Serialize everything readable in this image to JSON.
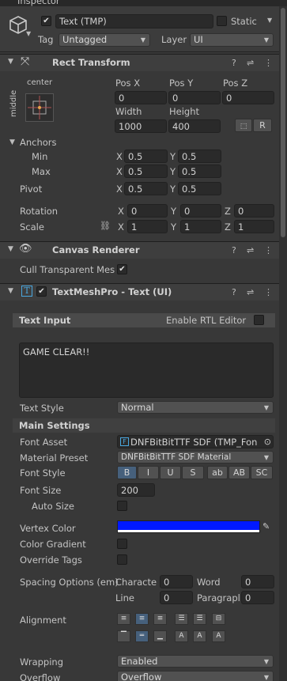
{
  "window": {
    "tab_title": "Inspector"
  },
  "object": {
    "active": true,
    "name": "Text (TMP)",
    "static_label": "Static",
    "static_checked": false,
    "tag_label": "Tag",
    "tag_value": "Untagged",
    "layer_label": "Layer",
    "layer_value": "UI"
  },
  "rect_transform": {
    "title": "Rect Transform",
    "anchor_preset_top": "center",
    "anchor_preset_side": "middle",
    "pos_x_label": "Pos X",
    "pos_y_label": "Pos Y",
    "pos_z_label": "Pos Z",
    "pos_x": "0",
    "pos_y": "0",
    "pos_z": "0",
    "width_label": "Width",
    "height_label": "Height",
    "width": "1000",
    "height": "400",
    "r_button": "R",
    "anchors_label": "Anchors",
    "min_label": "Min",
    "max_label": "Max",
    "x_label": "X",
    "y_label": "Y",
    "z_label": "Z",
    "min_x": "0.5",
    "min_y": "0.5",
    "max_x": "0.5",
    "max_y": "0.5",
    "pivot_label": "Pivot",
    "pivot_x": "0.5",
    "pivot_y": "0.5",
    "rotation_label": "Rotation",
    "rot_x": "0",
    "rot_y": "0",
    "rot_z": "0",
    "scale_label": "Scale",
    "scale_x": "1",
    "scale_y": "1",
    "scale_z": "1"
  },
  "canvas_renderer": {
    "title": "Canvas Renderer",
    "cull_label": "Cull Transparent Mes",
    "cull_checked": true
  },
  "tmp": {
    "title": "TextMeshPro - Text (UI)",
    "enabled": true,
    "text_input_label": "Text Input",
    "rtl_label": "Enable RTL Editor",
    "text_value": "GAME CLEAR!!",
    "text_style_label": "Text Style",
    "text_style_value": "Normal",
    "main_settings_label": "Main Settings",
    "font_asset_label": "Font Asset",
    "font_asset_value": "DNFBitBitTTF SDF (TMP_Fon",
    "material_preset_label": "Material Preset",
    "material_preset_value": "DNFBitBitTTF SDF Material",
    "font_style_label": "Font Style",
    "font_style_buttons": [
      "B",
      "I",
      "U",
      "S",
      "ab",
      "AB",
      "SC"
    ],
    "font_size_label": "Font Size",
    "font_size_value": "200",
    "auto_size_label": "Auto Size",
    "vertex_color_label": "Vertex Color",
    "vertex_color": "#0019ff",
    "color_gradient_label": "Color Gradient",
    "override_tags_label": "Override Tags",
    "spacing_label": "Spacing Options (em)",
    "character_label": "Characte",
    "character_value": "0",
    "word_label": "Word",
    "word_value": "0",
    "line_label": "Line",
    "line_value": "0",
    "paragraph_label": "Paragrapl",
    "paragraph_value": "0",
    "alignment_label": "Alignment",
    "wrapping_label": "Wrapping",
    "wrapping_value": "Enabled",
    "overflow_label": "Overflow",
    "overflow_value": "Overflow"
  }
}
